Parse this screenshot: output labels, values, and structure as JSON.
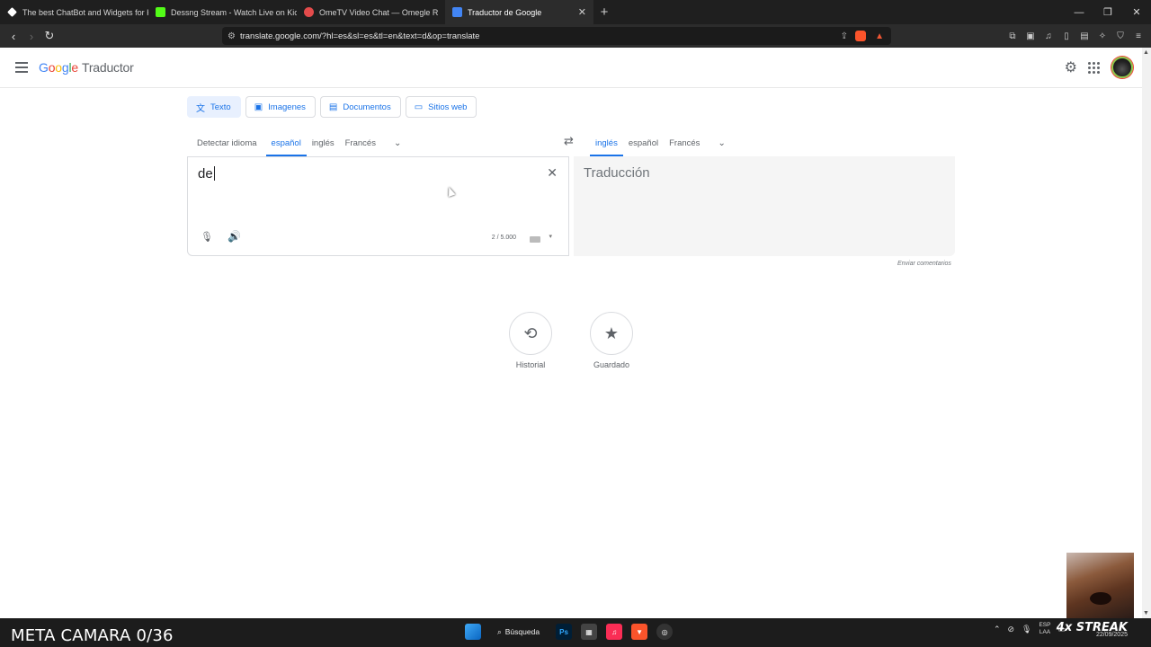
{
  "tabs": [
    {
      "title": "The best ChatBot and Widgets for Kic",
      "color": "#ffffff"
    },
    {
      "title": "Dessng Stream - Watch Live on Kick",
      "color": "#53fc18"
    },
    {
      "title": "OmeTV Video Chat — Omegle R",
      "color": "#e34b4b"
    },
    {
      "title": "Traductor de Google",
      "color": "#4285f4"
    }
  ],
  "url": "translate.google.com/?hl=es&sl=es&tl=en&text=d&op=translate",
  "header": {
    "logo_letters": [
      "G",
      "o",
      "o",
      "g",
      "l",
      "e"
    ],
    "product": "Traductor"
  },
  "modes": [
    {
      "label": "Texto",
      "icon": "translate-icon"
    },
    {
      "label": "Imagenes",
      "icon": "image-icon"
    },
    {
      "label": "Documentos",
      "icon": "document-icon"
    },
    {
      "label": "Sitios web",
      "icon": "web-icon"
    }
  ],
  "source_langs": [
    "Detectar idioma",
    "español",
    "inglés",
    "Francés"
  ],
  "target_langs": [
    "inglés",
    "español",
    "Francés"
  ],
  "source": {
    "text": "de",
    "count": "2 / 5.000"
  },
  "target": {
    "placeholder": "Traducción"
  },
  "feedback": "Enviar comentarios",
  "bottom": {
    "history": "Historial",
    "saved": "Guardado"
  },
  "taskbar": {
    "overlay": "META CAMARA 0/36",
    "search": "Búsqueda",
    "lang": "ESP",
    "lang2": "LAA",
    "streak": "4x STREAK",
    "date": "22/09/2025"
  },
  "colors": {
    "accent": "#1a73e8",
    "chrome": "#2c2c2c"
  }
}
